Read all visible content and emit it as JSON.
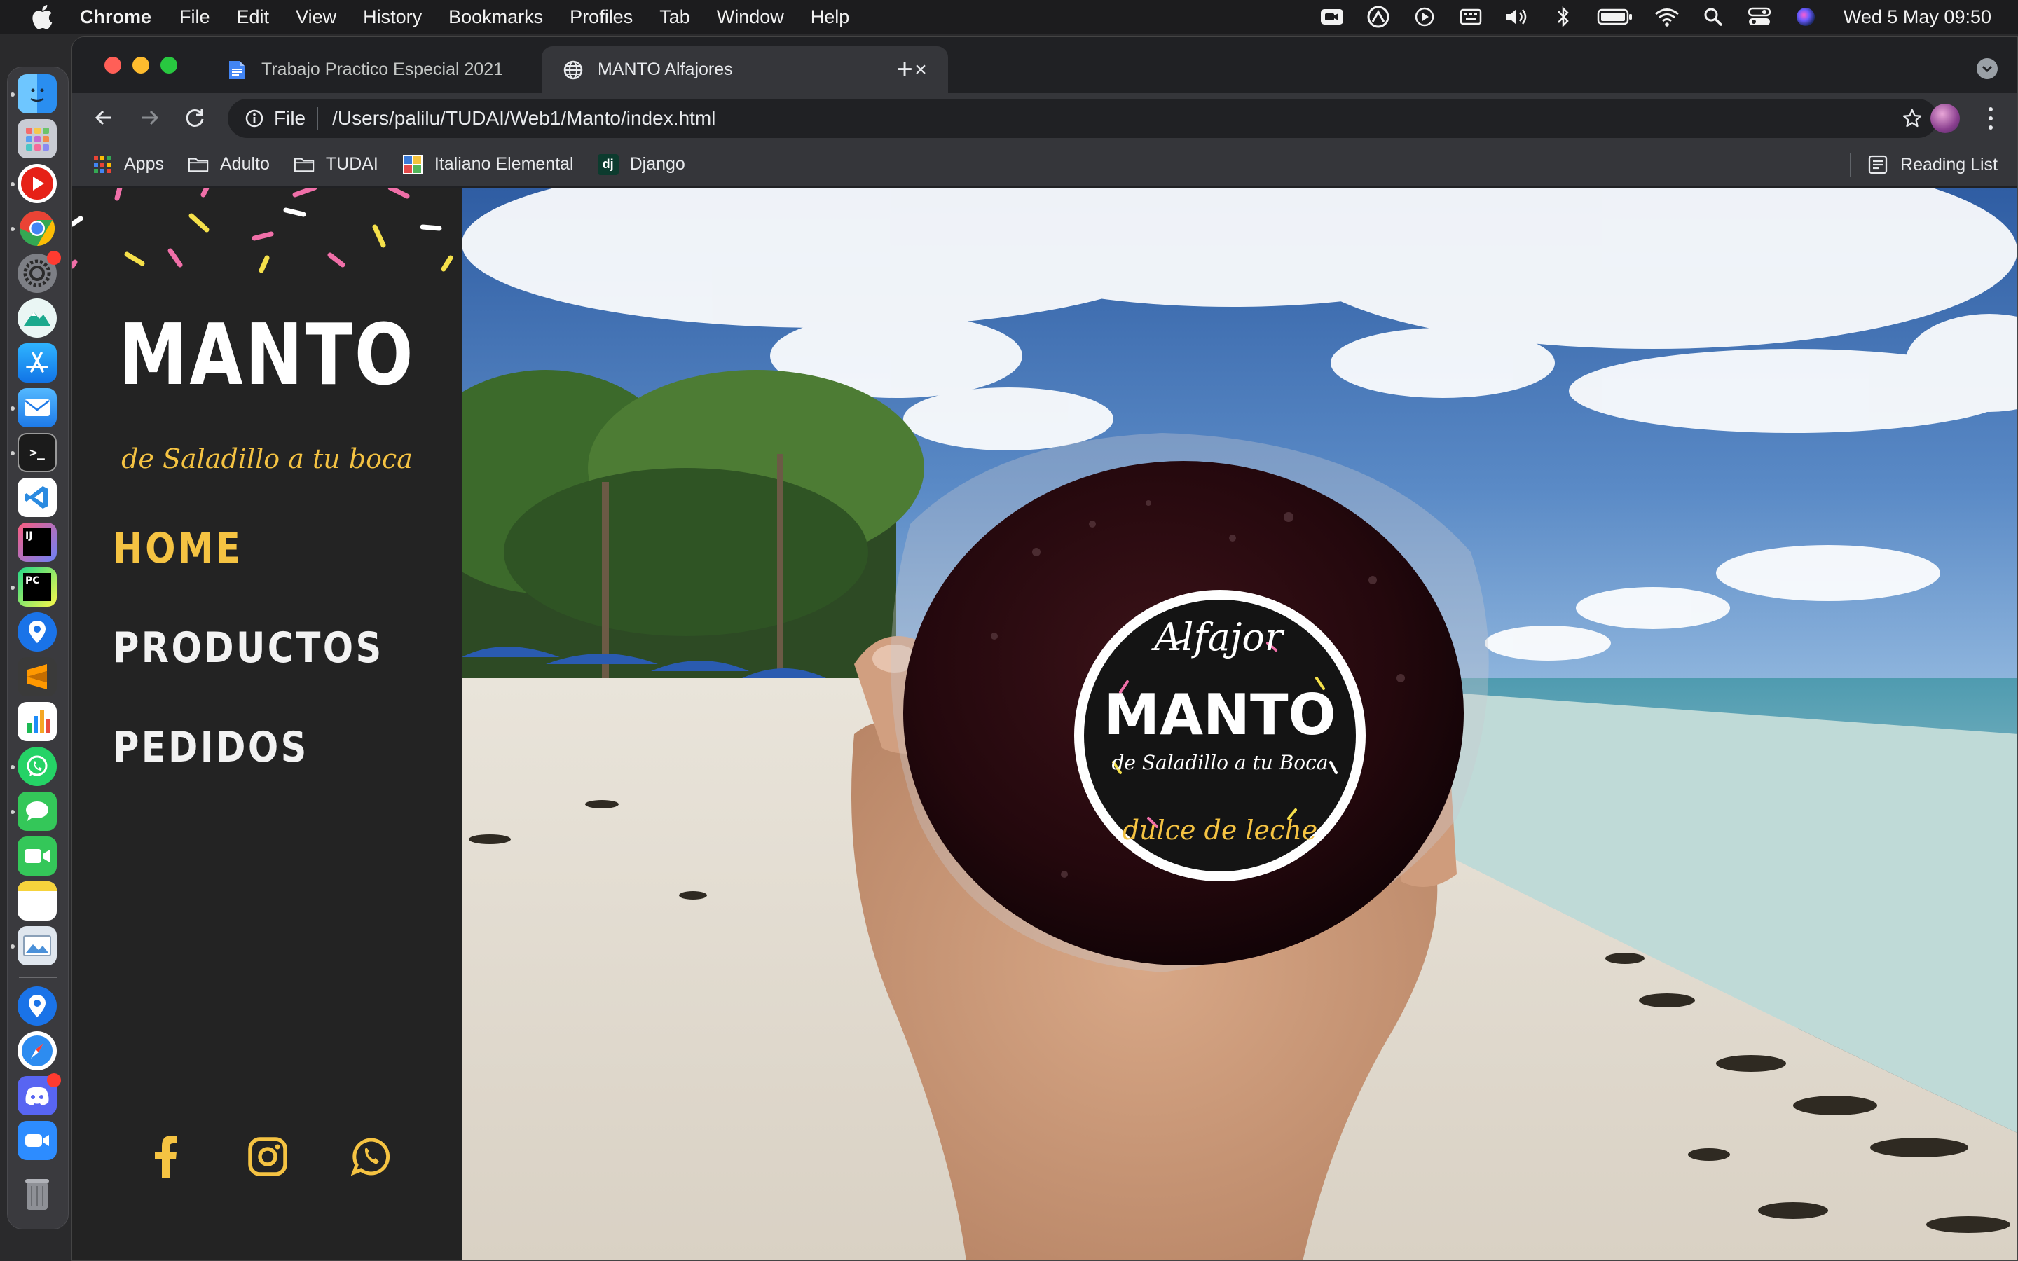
{
  "menubar": {
    "app_name": "Chrome",
    "menus": [
      "File",
      "Edit",
      "View",
      "History",
      "Bookmarks",
      "Profiles",
      "Tab",
      "Window",
      "Help"
    ],
    "status_icons": [
      "facetime-icon",
      "siri-remote-icon",
      "play-icon",
      "keyboard-icon",
      "volume-icon",
      "bluetooth-icon",
      "battery-icon",
      "wifi-icon",
      "spotlight-search-icon",
      "control-center-icon",
      "siri-icon"
    ],
    "clock": "Wed 5 May  09:50"
  },
  "dock": {
    "apps": [
      "finder",
      "launchpad",
      "youtube",
      "chrome",
      "system-preferences",
      "mountain",
      "app-store",
      "mail",
      "terminal",
      "vscode",
      "intellij",
      "pycharm",
      "maps-pin",
      "sublime-text",
      "numbers",
      "whatsapp",
      "messages",
      "facetime",
      "notes",
      "preview",
      "maps-pin-2",
      "safari",
      "discord",
      "zoom",
      "trash"
    ]
  },
  "browser": {
    "tabs": [
      {
        "title": "Trabajo Practico Especial 2021",
        "active": false,
        "favicon": "google-docs-icon"
      },
      {
        "title": "MANTO Alfajores",
        "active": true,
        "favicon": "globe-icon"
      }
    ],
    "omnibox": {
      "scheme": "File",
      "url": "/Users/palilu/TUDAI/Web1/Manto/index.html"
    },
    "bookmarks": [
      {
        "label": "Apps",
        "icon": "apps-grid-icon"
      },
      {
        "label": "Adulto",
        "icon": "folder-icon"
      },
      {
        "label": "TUDAI",
        "icon": "folder-icon"
      },
      {
        "label": "Italiano Elemental",
        "icon": "site-favicon-icon"
      },
      {
        "label": "Django",
        "icon": "django-icon"
      }
    ],
    "reading_list": "Reading List",
    "django_glyph": "dj"
  },
  "page": {
    "brand": "MANTO",
    "tagline": "de Saladillo a tu boca",
    "nav": [
      {
        "label": "HOME",
        "current": true
      },
      {
        "label": "PRODUCTOS",
        "current": false
      },
      {
        "label": "PEDIDOS",
        "current": false
      }
    ],
    "social": [
      "facebook-icon",
      "instagram-icon",
      "whatsapp-icon"
    ],
    "hero_label": {
      "top": "Alfajor",
      "brand": "MANTO",
      "subtitle": "de Saladillo a tu Boca",
      "bottom": "dulce de leche"
    },
    "colors": {
      "accent": "#f5c342",
      "sidebar_bg": "#232323",
      "confetti_pink": "#f06fa8",
      "confetti_yellow": "#f5e04a",
      "confetti_white": "#ffffff"
    }
  }
}
